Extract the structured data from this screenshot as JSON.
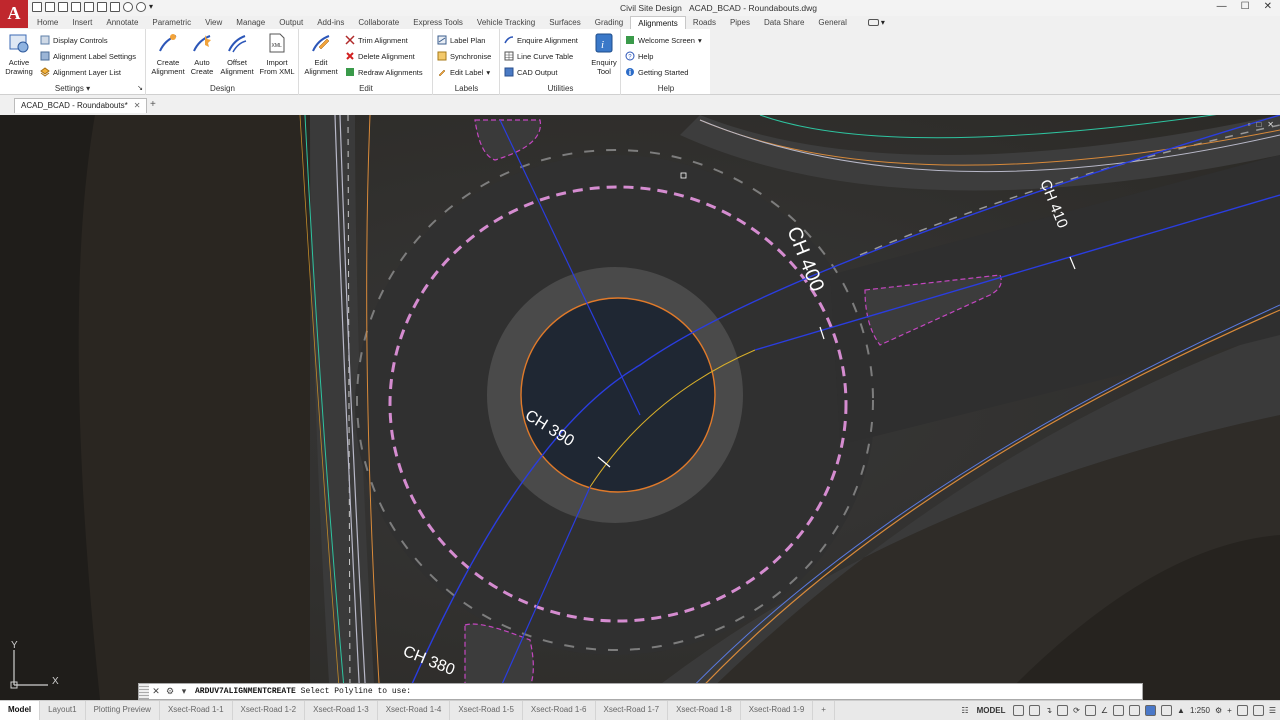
{
  "window": {
    "app_name": "Civil Site Design",
    "file_title": "ACAD_BCAD - Roundabouts.dwg",
    "controls": [
      "—",
      "☐",
      "✕"
    ]
  },
  "app_logo": "A",
  "ribbon_tabs": [
    "Home",
    "Insert",
    "Annotate",
    "Parametric",
    "View",
    "Manage",
    "Output",
    "Add-ins",
    "Collaborate",
    "Express Tools",
    "Vehicle Tracking",
    "Surfaces",
    "Grading",
    "Alignments",
    "Roads",
    "Pipes",
    "Data Share",
    "General"
  ],
  "active_tab": "Alignments",
  "panels": {
    "settings": {
      "title": "Settings",
      "big": {
        "label_1": "Active",
        "label_2": "Drawing"
      },
      "items": [
        "Display Controls",
        "Alignment Label Settings",
        "Alignment Layer List"
      ]
    },
    "design": {
      "title": "Design",
      "buttons": [
        {
          "line1": "Create",
          "line2": "Alignment"
        },
        {
          "line1": "Auto",
          "line2": "Create"
        },
        {
          "line1": "Offset",
          "line2": "Alignment"
        },
        {
          "line1": "Import",
          "line2": "From XML"
        }
      ]
    },
    "edit": {
      "title": "Edit",
      "big": {
        "line1": "Edit",
        "line2": "Alignment"
      },
      "items": [
        "Trim Alignment",
        "Delete Alignment",
        "Redraw Alignments"
      ]
    },
    "labels": {
      "title": "Labels",
      "items": [
        "Label Plan",
        "Synchronise",
        "Edit Label"
      ]
    },
    "utilities": {
      "title": "Utilities",
      "items": [
        "Enquire Alignment",
        "Line Curve Table",
        "CAD Output"
      ],
      "big": {
        "line1": "Enquiry",
        "line2": "Tool"
      }
    },
    "help": {
      "title": "Help",
      "items": [
        "Welcome Screen",
        "Help",
        "Getting  Started"
      ]
    }
  },
  "doc_tab": {
    "label": "ACAD_BCAD - Roundabouts*",
    "close": "✕",
    "add": "+"
  },
  "drawing": {
    "chainage_labels": [
      "CH 410",
      "CH 400",
      "CH 390",
      "CH 380"
    ],
    "ucs": {
      "x": "X",
      "y": "Y"
    },
    "colors": {
      "asphalt": "#2e2e2e",
      "alignment": "#2a3de0",
      "roundabout_circle": "#d58cd0",
      "island_circle": "#e07a2a",
      "label": "#ffffff"
    }
  },
  "command_line": {
    "command": "ARDUV7ALIGNMENTCREATE",
    "prompt": "Select Polyline to use:"
  },
  "layout_tabs": [
    "Model",
    "Layout1",
    "Plotting Preview",
    "Xsect-Road 1-1",
    "Xsect-Road 1-2",
    "Xsect-Road 1-3",
    "Xsect-Road 1-4",
    "Xsect-Road 1-5",
    "Xsect-Road 1-6",
    "Xsect-Road 1-7",
    "Xsect-Road 1-8",
    "Xsect-Road 1-9",
    "+"
  ],
  "status": {
    "model": "MODEL",
    "scale": "1:250"
  }
}
